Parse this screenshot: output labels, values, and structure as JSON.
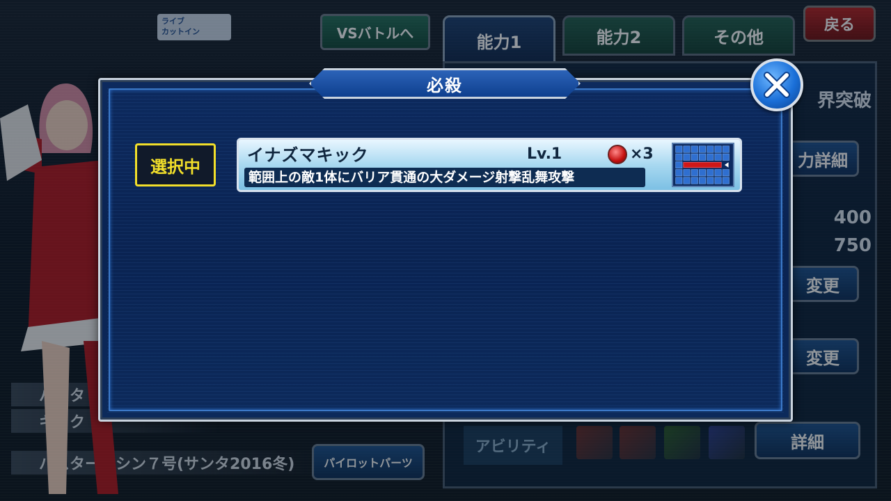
{
  "header": {
    "live_cutin_label": "ライブ\nカットイン",
    "vs_battle_label": "VSバトルへ",
    "back_label": "戻る"
  },
  "tabs": [
    {
      "label": "能力1",
      "active": true
    },
    {
      "label": "能力2",
      "active": false
    },
    {
      "label": "その他",
      "active": false
    }
  ],
  "right_panel": {
    "limit_break_label": "界突破",
    "ability_detail_label": "力詳細",
    "stat_1": "400",
    "stat_2": "750",
    "change_label_1": "変更",
    "change_label_2": "変更",
    "ability_label": "アビリティ",
    "detail_label": "詳細"
  },
  "bottom_left": {
    "row_1": "バスタ",
    "row_2": "キック",
    "machine_name": "バスターマシン７号(サンタ2016冬)",
    "pilot_parts_label": "パイロットパーツ"
  },
  "modal": {
    "title": "必殺",
    "selected_label": "選択中",
    "skill": {
      "name": "イナズマキック",
      "level": "Lv.1",
      "cost": "×3",
      "description": "範囲上の敵1体にバリア貫通の大ダメージ射撃乱舞攻撃"
    }
  },
  "colors": {
    "modal_bg": "#0b2656",
    "selected_badge": "#f2df2a",
    "back_button": "#b11c1c",
    "range_highlight": "#d01818"
  }
}
